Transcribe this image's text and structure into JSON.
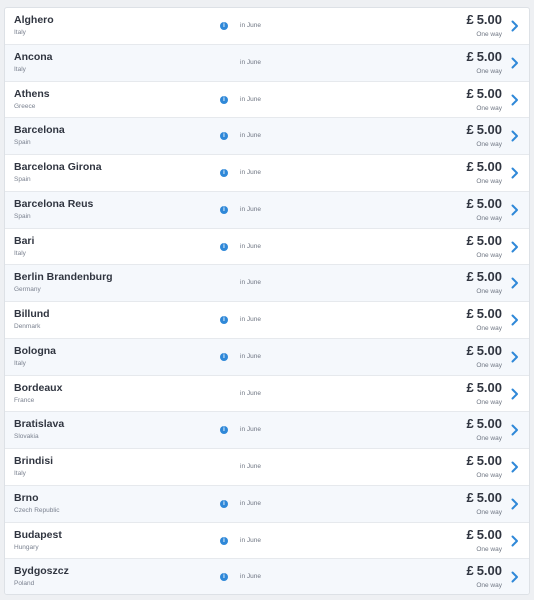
{
  "currency": "£",
  "price": "5.00",
  "price_note": "One way",
  "period": "in June",
  "destinations": [
    {
      "city": "Alghero",
      "country": "Italy",
      "info": true
    },
    {
      "city": "Ancona",
      "country": "Italy",
      "info": false
    },
    {
      "city": "Athens",
      "country": "Greece",
      "info": true
    },
    {
      "city": "Barcelona",
      "country": "Spain",
      "info": true
    },
    {
      "city": "Barcelona Girona",
      "country": "Spain",
      "info": true
    },
    {
      "city": "Barcelona Reus",
      "country": "Spain",
      "info": true
    },
    {
      "city": "Bari",
      "country": "Italy",
      "info": true
    },
    {
      "city": "Berlin Brandenburg",
      "country": "Germany",
      "info": false
    },
    {
      "city": "Billund",
      "country": "Denmark",
      "info": true
    },
    {
      "city": "Bologna",
      "country": "Italy",
      "info": true
    },
    {
      "city": "Bordeaux",
      "country": "France",
      "info": false
    },
    {
      "city": "Bratislava",
      "country": "Slovakia",
      "info": true
    },
    {
      "city": "Brindisi",
      "country": "Italy",
      "info": false
    },
    {
      "city": "Brno",
      "country": "Czech Republic",
      "info": true
    },
    {
      "city": "Budapest",
      "country": "Hungary",
      "info": true
    },
    {
      "city": "Bydgoszcz",
      "country": "Poland",
      "info": true
    }
  ],
  "colors": {
    "accent": "#2f88d8",
    "text": "#303540",
    "muted": "#7b8290"
  },
  "icons": {
    "info": "info-icon",
    "chevron": "chevron-right-icon"
  }
}
